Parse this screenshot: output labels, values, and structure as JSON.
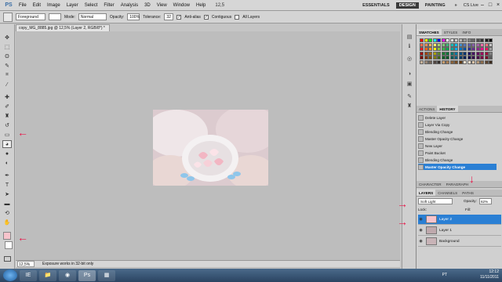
{
  "menubar": {
    "logo": "PS",
    "items": [
      "File",
      "Edit",
      "Image",
      "Layer",
      "Select",
      "Filter",
      "Analysis",
      "3D",
      "View",
      "Window",
      "Help"
    ],
    "zoom": "12,5",
    "workspaces": [
      "ESSENTIALS",
      "DESIGN",
      "PAINTING"
    ],
    "active_workspace": "DESIGN",
    "more": "»",
    "cslive": "CS Live",
    "window_controls": [
      "–",
      "□",
      "×"
    ]
  },
  "options": {
    "source": "Foreground",
    "mode_label": "Mode:",
    "mode": "Normal",
    "opacity_label": "Opacity:",
    "opacity": "100%",
    "tolerance_label": "Tolerance:",
    "tolerance": "32",
    "antialias": "Anti-alias",
    "contiguous": "Contiguous",
    "all_layers": "All Layers"
  },
  "document": {
    "tab_title": "copy_MG_8885.jpg @ 12,5% (Layer 2, RGB/8*) *",
    "status_zoom": "12,5%",
    "status_text": "Exposure works in 32-bit only"
  },
  "swatches_panel": {
    "tabs": [
      "SWATCHES",
      "STYLES",
      "INFO"
    ],
    "colors": [
      "#ff0000",
      "#ffff00",
      "#00ff00",
      "#00ffff",
      "#0000ff",
      "#ff00ff",
      "#ffffff",
      "#e6e6e6",
      "#cccccc",
      "#b3b3b3",
      "#999999",
      "#808080",
      "#666666",
      "#4d4d4d",
      "#333333",
      "#1a1a1a",
      "#000000",
      "#f26c4f",
      "#f68e55",
      "#fbaf5c",
      "#fff467",
      "#acd372",
      "#7cc576",
      "#3bb878",
      "#1abbb4",
      "#00bff3",
      "#438ccb",
      "#5574b9",
      "#605ca8",
      "#855fa8",
      "#a763a8",
      "#f06ea9",
      "#f26d7d",
      "#c4c4c4",
      "#ed1c24",
      "#f26522",
      "#f7941d",
      "#fff200",
      "#8dc63f",
      "#39b54a",
      "#00a651",
      "#00a99d",
      "#00aeef",
      "#0072bc",
      "#0054a6",
      "#2e3192",
      "#662d91",
      "#92278f",
      "#ec008c",
      "#ed145b",
      "#a0a0a0",
      "#9e0b0f",
      "#a0410d",
      "#a3620a",
      "#aba000",
      "#598527",
      "#1a7b30",
      "#007236",
      "#00746b",
      "#0076a3",
      "#004b80",
      "#003471",
      "#1b1464",
      "#440e62",
      "#630460",
      "#9e005d",
      "#9e0039",
      "#7f7f7f",
      "#790000",
      "#7b2e00",
      "#7d4900",
      "#827b00",
      "#406618",
      "#005e20",
      "#005826",
      "#005952",
      "#005b7f",
      "#003663",
      "#002157",
      "#0d004c",
      "#32004b",
      "#4b0049",
      "#7b0046",
      "#7a0026",
      "#595959",
      "#c7b299",
      "#998675",
      "#736357",
      "#534741",
      "#37302d",
      "#c69c6d",
      "#a67c52",
      "#8c6239",
      "#754c24",
      "#603913",
      "#f5e6d3",
      "#eddcc8",
      "#d9c2a7",
      "#b89a7a",
      "#8f6e4d",
      "#5e4430",
      "#3b2a1d"
    ]
  },
  "history_panel": {
    "tabs": [
      "ACTIONS",
      "HISTORY"
    ],
    "active_tab": "HISTORY",
    "items": [
      "Delete Layer",
      "Layer Via Copy",
      "Blending Change",
      "Master Opacity Change",
      "New Layer",
      "Paint Bucket",
      "Blending Change",
      "Master Opacity Change"
    ],
    "selected_index": 7
  },
  "character_tabs": [
    "CHARACTER",
    "PARAGRAPH"
  ],
  "layers_panel": {
    "tabs": [
      "LAYERS",
      "CHANNELS",
      "PATHS"
    ],
    "active_tab": "LAYERS",
    "blend_mode": "Soft Light",
    "opacity_label": "Opacity:",
    "opacity": "62%",
    "lock_label": "Lock:",
    "fill_label": "Fill:",
    "layers": [
      {
        "name": "Layer 2",
        "thumb": "#f7c4cc",
        "selected": true
      },
      {
        "name": "Layer 1",
        "thumb": "#bfa9ad",
        "selected": false
      },
      {
        "name": "Background",
        "thumb": "#c8b3b7",
        "selected": false
      }
    ]
  },
  "taskbar": {
    "apps": [
      "IE",
      "📁",
      "◉",
      "Ps",
      "▦"
    ],
    "active_app": 3,
    "lang": "PT",
    "time": "12:12",
    "date": "11/11/2011"
  },
  "colors": {
    "annotation_red": "#e8184a",
    "selection_blue": "#2a7fd4",
    "foreground_color": "#f7c4cc"
  }
}
